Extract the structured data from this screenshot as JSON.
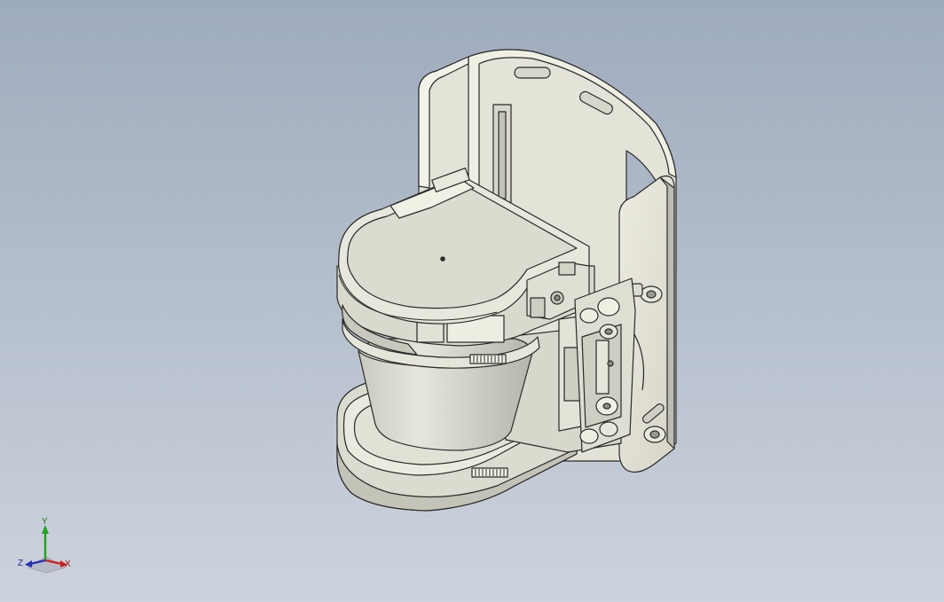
{
  "window": {
    "background_top": "#9eabbd",
    "background_bottom": "#cdd3dd"
  },
  "model": {
    "name": "",
    "body_color": "#e8e8dc",
    "edge_color": "#2a2a2a"
  },
  "triad": {
    "y_label": "Y",
    "x_label": "X",
    "z_label": "Z",
    "y_color": "#22a022",
    "x_color": "#d02020",
    "z_color": "#2030c0"
  }
}
